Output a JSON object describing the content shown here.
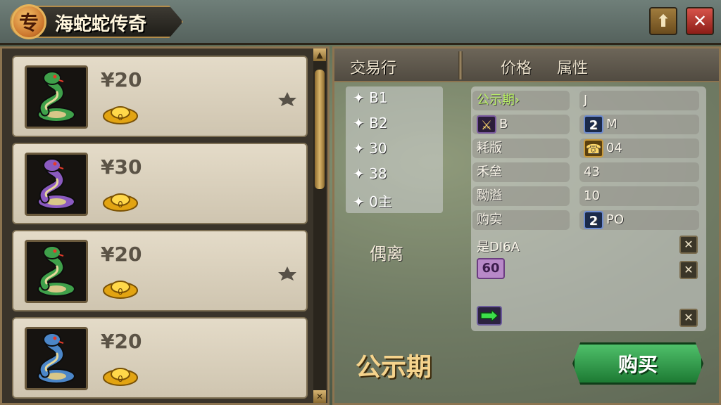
{
  "header": {
    "badge_glyph": "专",
    "title": "海蛇蛇传奇"
  },
  "items": [
    {
      "price": "¥20",
      "ingot": "0",
      "snake_color": "#3fa04a",
      "marked": true
    },
    {
      "price": "¥30",
      "ingot": "0",
      "snake_color": "#8b5ac0",
      "marked": false
    },
    {
      "price": "¥20",
      "ingot": "0",
      "snake_color": "#3fa04a",
      "marked": true
    },
    {
      "price": "¥20",
      "ingot": "0",
      "snake_color": "#4b86c8",
      "marked": false
    }
  ],
  "right": {
    "tab_market": "交易行",
    "col_price": "价格",
    "col_attr": "属性",
    "categories": [
      "✦ B1",
      "✦ B2",
      "✦ 30",
      "✦ 38",
      "✦ 0主"
    ],
    "side_label": "偶离",
    "footer_label": "公示期",
    "buy_label": "购买"
  },
  "attributes": {
    "rows": [
      {
        "left": "公示期›",
        "right": "J"
      },
      {
        "left": "B",
        "right": "M",
        "right_badge": "2"
      },
      {
        "left": "耗版",
        "right": "04"
      },
      {
        "left": "禾垒",
        "right": "43"
      },
      {
        "left": "黝溢",
        "right": "10"
      },
      {
        "left": "购实",
        "right": "PO",
        "right_badge": "2"
      }
    ],
    "line7": "是DI6A",
    "badge_60": "60"
  },
  "colors": {
    "accent_gold": "#b38c4a",
    "buy_green": "#2fa04a",
    "close_red": "#c23a30"
  }
}
